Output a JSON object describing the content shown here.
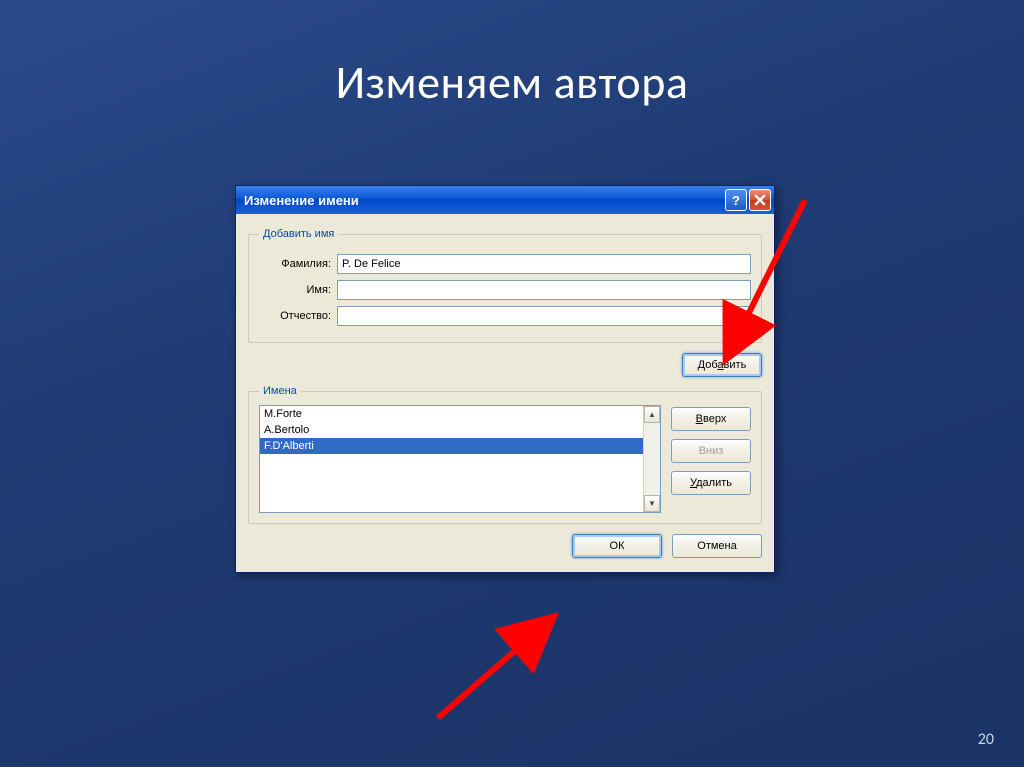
{
  "slide": {
    "title": "Изменяем автора",
    "number": "20"
  },
  "dialog": {
    "title": "Изменение имени",
    "groupAdd": "Добавить имя",
    "labels": {
      "surname": "Фамилия:",
      "name": "Имя:",
      "patronymic": "Отчество:"
    },
    "values": {
      "surname": "P. De Felice",
      "name": "",
      "patronymic": ""
    },
    "buttons": {
      "add": "Добавить",
      "up": "Вверх",
      "down": "Вниз",
      "delete": "Удалить",
      "ok": "ОК",
      "cancel": "Отмена"
    },
    "groupNames": "Имена",
    "nameList": [
      "M.Forte",
      "A.Bertolo",
      "F.D'Alberti"
    ],
    "selectedIndex": 2,
    "helpGlyph": "?"
  }
}
